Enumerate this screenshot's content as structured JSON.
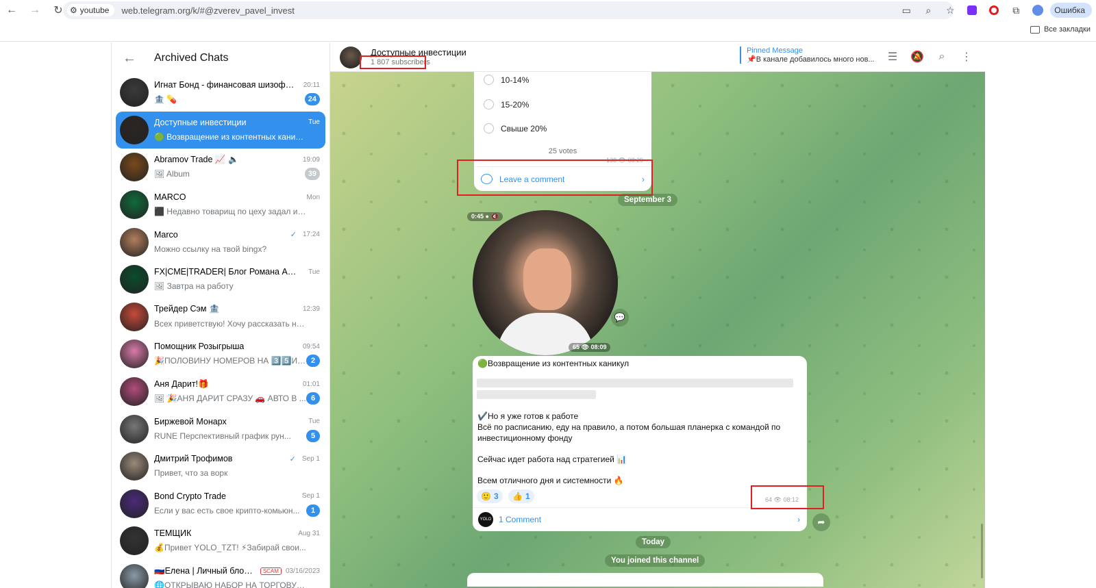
{
  "browser": {
    "omni_chip": "youtube",
    "url": "web.telegram.org/k/#@zverev_pavel_invest",
    "profile_status": "Ошибка",
    "bookmarks_label": "Все закладки"
  },
  "sidebar": {
    "title": "Archived Chats",
    "chats": [
      {
        "name": "Игнат Бонд - финансовая шизофре...",
        "time": "20:11",
        "msg": "🏦 💊",
        "badge": "24",
        "muted": false,
        "avatar": "#3a3a3a"
      },
      {
        "name": "Доступные инвестиции",
        "time": "Tue",
        "msg": "🟢 Возвращение из контентных каникул ...",
        "badge": "",
        "muted": false,
        "active": true,
        "avatar": "#2b2622"
      },
      {
        "name": "Abramov Trade 📈 🔈",
        "time": "19:09",
        "msg": "🖼 Album",
        "badge": "39",
        "muted": true,
        "avatar": "#7a4a1a"
      },
      {
        "name": "MARCO",
        "time": "Mon",
        "msg": "⬛ Недавно товарищ по цеху задал инте...",
        "badge": "",
        "muted": false,
        "avatar": "#0f6b3a"
      },
      {
        "name": "Marco",
        "time": "17:24",
        "msg": "Можно ссылку на твой bingx?",
        "badge": "",
        "muted": false,
        "check": true,
        "avatar": "#b27e5c"
      },
      {
        "name": "FX|CME|TRADER| Блог Романа Анкуд...",
        "time": "Tue",
        "msg": "🖼 Завтра на работу",
        "badge": "",
        "muted": false,
        "avatar": "#0a4d2c"
      },
      {
        "name": "Трейдер Сэм 🏦",
        "time": "12:39",
        "msg": "Всех приветствую! Хочу рассказать нем...",
        "badge": "",
        "muted": false,
        "avatar": "#c84a3a"
      },
      {
        "name": "Помощник Розыгрыша",
        "time": "09:54",
        "msg": "🎉ПОЛОВИНУ НОМЕРОВ НА 3️⃣5️⃣ИГ...",
        "badge": "2",
        "muted": false,
        "avatar": "#d87aa8"
      },
      {
        "name": "Аня Дарит!🎁",
        "time": "01:01",
        "msg": "🖼 🎉АНЯ ДАРИТ СРАЗУ 🚗 АВТО В ...",
        "badge": "6",
        "muted": false,
        "avatar": "#b24c7a"
      },
      {
        "name": "Биржевой Монарх",
        "time": "Tue",
        "msg": "RUNE Перспективный график рун...",
        "badge": "5",
        "muted": false,
        "avatar": "#777"
      },
      {
        "name": "Дмитрий Трофимов",
        "time": "Sep 1",
        "msg": "Привет, что за ворк",
        "badge": "",
        "muted": false,
        "check": true,
        "avatar": "#9a8a7a"
      },
      {
        "name": "Bond Crypto Trade",
        "time": "Sep 1",
        "msg": "Если у вас есть свое крипто-комьюн...",
        "badge": "1",
        "muted": false,
        "avatar": "#4a2a7a"
      },
      {
        "name": "ТЕМЩИК",
        "time": "Aug 31",
        "msg": "💰Привет YOLO_TZT! ⚡Забирай свои...",
        "badge": "",
        "muted": false,
        "avatar": "#333"
      },
      {
        "name": "🇷🇺Елена | Личный блог!...",
        "time": "03/16/2023",
        "msg": "🌐ОТКРЫВАЮ НАБОР НА ТОРГОВУЮ СЕ...",
        "badge": "",
        "muted": false,
        "scam": "SCAM",
        "avatar": "#8a9aa8"
      }
    ]
  },
  "header": {
    "title": "Доступные инвестиции",
    "subscribers": "1 807 subscribers",
    "pinned_title": "Pinned Message",
    "pinned_text": "📌В канале добавилось много нов..."
  },
  "poll": {
    "options": [
      "10-14%",
      "15-20%",
      "Свыше 20%"
    ],
    "votes": "25 votes",
    "meta": "138 👁 08:29",
    "leave_comment": "Leave a comment"
  },
  "date_sep": "September 3",
  "video": {
    "duration": "0:45 ● 🔇",
    "meta": "65 👁 08:09"
  },
  "post": {
    "title": "🟢Возвращение из контентных каникул",
    "line1": "✔️Но я уже готов к работе",
    "line2": "Всё по расписанию, еду на правило, а потом большая планерка с командой по",
    "line3": "инвестиционному фонду",
    "line4": "Сейчас идет работа над стратегией 📊",
    "line5": "Всем отличного дня и системности 🔥",
    "react1_emoji": "🙂",
    "react1_count": "3",
    "react2_emoji": "👍",
    "react2_count": "1",
    "meta": "64 👁 08:12",
    "comments": "1 Comment",
    "comment_avatar": "YOLO"
  },
  "today": "Today",
  "joined": "You joined this channel"
}
